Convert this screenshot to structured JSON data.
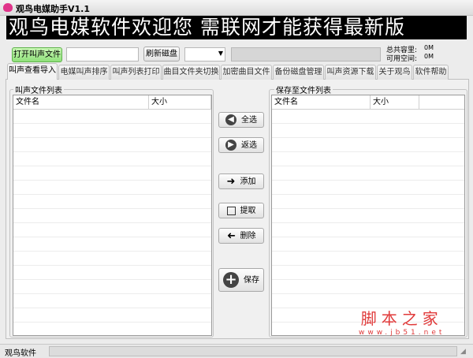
{
  "window": {
    "title": "观鸟电媒助手V1.1"
  },
  "banner": "观鸟电媒软件欢迎您  需联网才能获得最新版",
  "toolbar": {
    "open_label": "打开叫声文件",
    "path_value": "",
    "refresh_label": "刷新磁盘",
    "drive_value": "",
    "total_label": "总共容里:",
    "total_value": "0M",
    "free_label": "可用空间:",
    "free_value": "0M"
  },
  "tabs": [
    "叫声查看导入",
    "电媒叫声排序",
    "叫声列表打印",
    "曲目文件夹切换",
    "加密曲目文件",
    "备份磁盘管理",
    "叫声资源下载",
    "关于观鸟",
    "软件帮助"
  ],
  "left": {
    "title": "叫声文件列表",
    "col_name": "文件名",
    "col_size": "大小"
  },
  "right": {
    "title": "保存至文件列表",
    "col_name": "文件名",
    "col_size": "大小"
  },
  "actions": {
    "select_all": "全选",
    "invert": "返选",
    "add": "添加",
    "extract": "提取",
    "delete": "删除",
    "save": "保存"
  },
  "status": {
    "text": "观鸟软件"
  },
  "watermark": {
    "title": "脚本之家",
    "url": "www.jb51.net"
  }
}
